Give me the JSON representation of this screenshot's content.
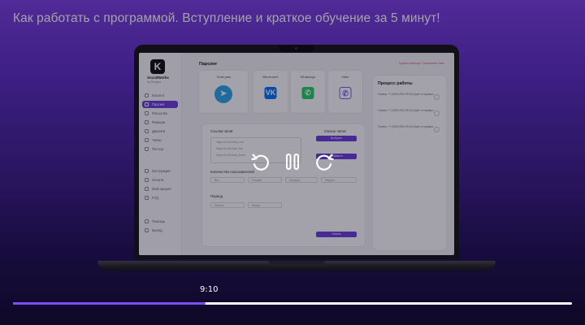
{
  "video": {
    "title": "Как работать с программой. Вступление и краткое обучение за 5 минут!",
    "hover_time": "9:10",
    "progress_fraction": 0.345,
    "accent_color": "#7c4dff",
    "controls": {
      "rewind_icon": "rotate-ccw-icon",
      "pause_icon": "pause-icon",
      "forward_icon": "rotate-cw-icon"
    }
  },
  "app": {
    "brand": "SocialWorks",
    "brand_sub": "by Bergus",
    "page_title": "Парсинг",
    "top_link": "Нужна помощь? Напишите нам",
    "nav": [
      "Каталог",
      "Парсинг",
      "Рассылка",
      "Реакции",
      "Диалоги",
      "Чекер",
      "Постер",
      "Инструкция",
      "Оплата",
      "Мой аккаунт",
      "FAQ",
      "Помощь",
      "Выход"
    ],
    "messengers": [
      {
        "name": "Телеграм",
        "icon": "telegram-icon",
        "glyph": "➤"
      },
      {
        "name": "ВКонтакте",
        "icon": "vk-icon",
        "glyph": "VK"
      },
      {
        "name": "WhatsApp",
        "icon": "whatsapp-icon",
        "glyph": "✆"
      },
      {
        "name": "Viber",
        "icon": "viber-icon",
        "glyph": "✆"
      }
    ],
    "process": {
      "title": "Процесс работы",
      "items": [
        "Номер +7 (999) 999-99-99 Идёт отправка",
        "Номер +7 (999) 999-99-99 Идёт отправка",
        "Номер +7 (999) 999-99-99 Идёт отправка"
      ]
    },
    "form": {
      "links_label": "Ссылки чатов",
      "links_lines": [
        "https://t.me/chat_one",
        "https://t.me/chat_two",
        "https://t.me/chat_three"
      ],
      "choose_label": "Список чатов",
      "choose_btn": "Выбрать",
      "add_btn": "Добавить",
      "members_label": "Количество пользователей",
      "params_label": "Период",
      "filters": [
        "Все",
        "Онлайн",
        "Сегодня",
        "Неделя"
      ],
      "periods": [
        "Начало",
        "Конец"
      ],
      "submit": "Начать"
    }
  }
}
